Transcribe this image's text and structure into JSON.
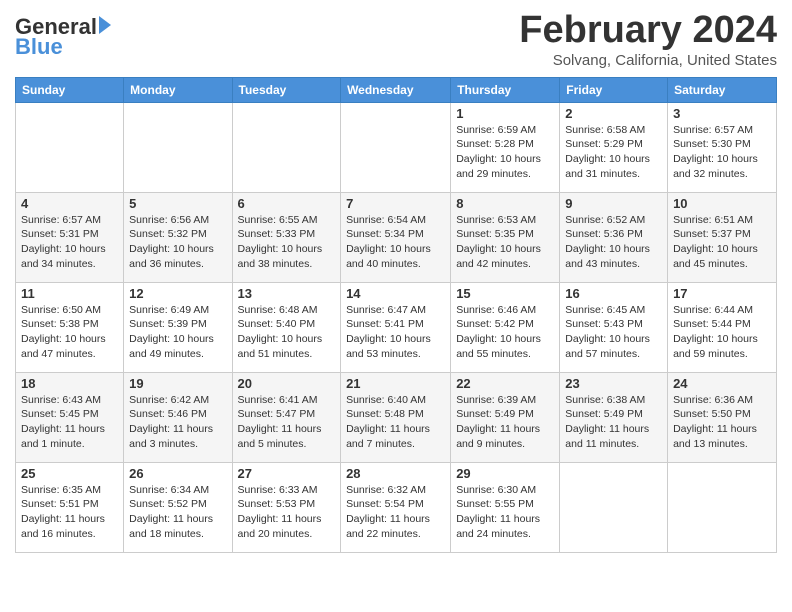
{
  "header": {
    "logo_line1": "General",
    "logo_line2": "Blue",
    "month": "February 2024",
    "location": "Solvang, California, United States"
  },
  "weekdays": [
    "Sunday",
    "Monday",
    "Tuesday",
    "Wednesday",
    "Thursday",
    "Friday",
    "Saturday"
  ],
  "weeks": [
    [
      {
        "day": "",
        "info": ""
      },
      {
        "day": "",
        "info": ""
      },
      {
        "day": "",
        "info": ""
      },
      {
        "day": "",
        "info": ""
      },
      {
        "day": "1",
        "info": "Sunrise: 6:59 AM\nSunset: 5:28 PM\nDaylight: 10 hours and 29 minutes."
      },
      {
        "day": "2",
        "info": "Sunrise: 6:58 AM\nSunset: 5:29 PM\nDaylight: 10 hours and 31 minutes."
      },
      {
        "day": "3",
        "info": "Sunrise: 6:57 AM\nSunset: 5:30 PM\nDaylight: 10 hours and 32 minutes."
      }
    ],
    [
      {
        "day": "4",
        "info": "Sunrise: 6:57 AM\nSunset: 5:31 PM\nDaylight: 10 hours and 34 minutes."
      },
      {
        "day": "5",
        "info": "Sunrise: 6:56 AM\nSunset: 5:32 PM\nDaylight: 10 hours and 36 minutes."
      },
      {
        "day": "6",
        "info": "Sunrise: 6:55 AM\nSunset: 5:33 PM\nDaylight: 10 hours and 38 minutes."
      },
      {
        "day": "7",
        "info": "Sunrise: 6:54 AM\nSunset: 5:34 PM\nDaylight: 10 hours and 40 minutes."
      },
      {
        "day": "8",
        "info": "Sunrise: 6:53 AM\nSunset: 5:35 PM\nDaylight: 10 hours and 42 minutes."
      },
      {
        "day": "9",
        "info": "Sunrise: 6:52 AM\nSunset: 5:36 PM\nDaylight: 10 hours and 43 minutes."
      },
      {
        "day": "10",
        "info": "Sunrise: 6:51 AM\nSunset: 5:37 PM\nDaylight: 10 hours and 45 minutes."
      }
    ],
    [
      {
        "day": "11",
        "info": "Sunrise: 6:50 AM\nSunset: 5:38 PM\nDaylight: 10 hours and 47 minutes."
      },
      {
        "day": "12",
        "info": "Sunrise: 6:49 AM\nSunset: 5:39 PM\nDaylight: 10 hours and 49 minutes."
      },
      {
        "day": "13",
        "info": "Sunrise: 6:48 AM\nSunset: 5:40 PM\nDaylight: 10 hours and 51 minutes."
      },
      {
        "day": "14",
        "info": "Sunrise: 6:47 AM\nSunset: 5:41 PM\nDaylight: 10 hours and 53 minutes."
      },
      {
        "day": "15",
        "info": "Sunrise: 6:46 AM\nSunset: 5:42 PM\nDaylight: 10 hours and 55 minutes."
      },
      {
        "day": "16",
        "info": "Sunrise: 6:45 AM\nSunset: 5:43 PM\nDaylight: 10 hours and 57 minutes."
      },
      {
        "day": "17",
        "info": "Sunrise: 6:44 AM\nSunset: 5:44 PM\nDaylight: 10 hours and 59 minutes."
      }
    ],
    [
      {
        "day": "18",
        "info": "Sunrise: 6:43 AM\nSunset: 5:45 PM\nDaylight: 11 hours and 1 minute."
      },
      {
        "day": "19",
        "info": "Sunrise: 6:42 AM\nSunset: 5:46 PM\nDaylight: 11 hours and 3 minutes."
      },
      {
        "day": "20",
        "info": "Sunrise: 6:41 AM\nSunset: 5:47 PM\nDaylight: 11 hours and 5 minutes."
      },
      {
        "day": "21",
        "info": "Sunrise: 6:40 AM\nSunset: 5:48 PM\nDaylight: 11 hours and 7 minutes."
      },
      {
        "day": "22",
        "info": "Sunrise: 6:39 AM\nSunset: 5:49 PM\nDaylight: 11 hours and 9 minutes."
      },
      {
        "day": "23",
        "info": "Sunrise: 6:38 AM\nSunset: 5:49 PM\nDaylight: 11 hours and 11 minutes."
      },
      {
        "day": "24",
        "info": "Sunrise: 6:36 AM\nSunset: 5:50 PM\nDaylight: 11 hours and 13 minutes."
      }
    ],
    [
      {
        "day": "25",
        "info": "Sunrise: 6:35 AM\nSunset: 5:51 PM\nDaylight: 11 hours and 16 minutes."
      },
      {
        "day": "26",
        "info": "Sunrise: 6:34 AM\nSunset: 5:52 PM\nDaylight: 11 hours and 18 minutes."
      },
      {
        "day": "27",
        "info": "Sunrise: 6:33 AM\nSunset: 5:53 PM\nDaylight: 11 hours and 20 minutes."
      },
      {
        "day": "28",
        "info": "Sunrise: 6:32 AM\nSunset: 5:54 PM\nDaylight: 11 hours and 22 minutes."
      },
      {
        "day": "29",
        "info": "Sunrise: 6:30 AM\nSunset: 5:55 PM\nDaylight: 11 hours and 24 minutes."
      },
      {
        "day": "",
        "info": ""
      },
      {
        "day": "",
        "info": ""
      }
    ]
  ]
}
